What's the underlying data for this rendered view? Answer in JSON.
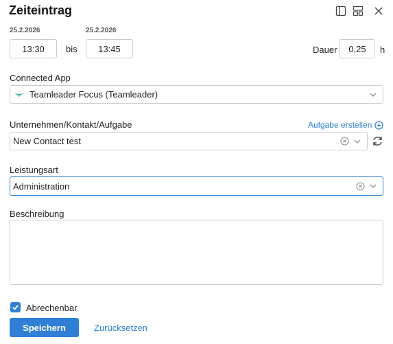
{
  "dialog": {
    "title": "Zeiteintrag",
    "icons": [
      "sidebar-layout-icon",
      "panel-layout-icon",
      "close-icon"
    ]
  },
  "time": {
    "start_date": "25.2.2026",
    "start_time": "13:30",
    "separator": "bis",
    "end_date": "25.2.2026",
    "end_time": "13:45",
    "duration_label": "Dauer",
    "duration_value": "0,25",
    "duration_unit": "h"
  },
  "connected_app": {
    "label": "Connected App",
    "value": "Teamleader Focus (Teamleader)"
  },
  "company": {
    "label": "Unternehmen/Kontakt/Aufgabe",
    "create_task_link": "Aufgabe erstellen",
    "value": "New Contact test"
  },
  "service_type": {
    "label": "Leistungsart",
    "value": "Administration"
  },
  "description": {
    "label": "Beschreibung",
    "value": ""
  },
  "billable": {
    "label": "Abrechenbar",
    "checked": true
  },
  "actions": {
    "save": "Speichern",
    "reset": "Zurücksetzen"
  },
  "colors": {
    "accent": "#2f7fd6",
    "teamleader_logo": "#2fb8a6"
  }
}
